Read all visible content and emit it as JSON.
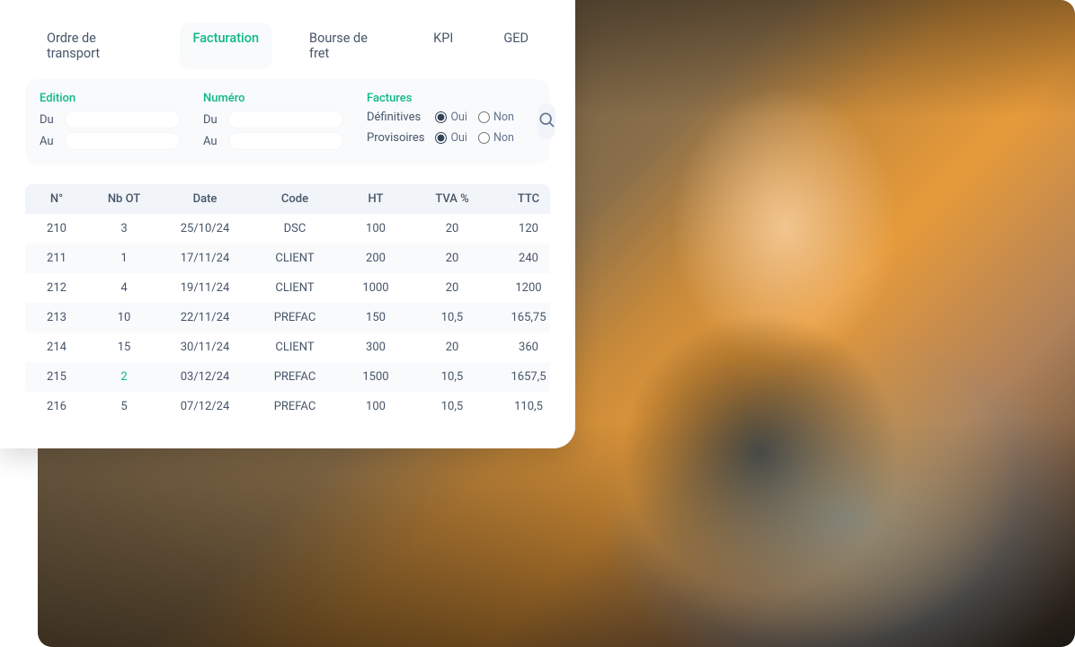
{
  "tabs": [
    {
      "label": "Ordre de transport"
    },
    {
      "label": "Facturation"
    },
    {
      "label": "Bourse de fret"
    },
    {
      "label": "KPI"
    },
    {
      "label": "GED"
    }
  ],
  "active_tab_index": 1,
  "filters": {
    "edition": {
      "title": "Edition",
      "from_label": "Du",
      "to_label": "Au",
      "from_value": "",
      "to_value": ""
    },
    "numero": {
      "title": "Numéro",
      "from_label": "Du",
      "to_label": "Au",
      "from_value": "",
      "to_value": ""
    },
    "factures": {
      "title": "Factures",
      "definitives_label": "Définitives",
      "provisoires_label": "Provisoires",
      "yes": "Oui",
      "no": "Non",
      "definitives_value": "Oui",
      "provisoires_value": "Oui"
    }
  },
  "table": {
    "headers": [
      "N°",
      "Nb OT",
      "Date",
      "Code",
      "HT",
      "TVA %",
      "TTC"
    ],
    "rows": [
      {
        "no": "210",
        "nb_ot": "3",
        "date": "25/10/24",
        "code": "DSC",
        "ht": "100",
        "tva": "20",
        "ttc": "120"
      },
      {
        "no": "211",
        "nb_ot": "1",
        "date": "17/11/24",
        "code": "CLIENT",
        "ht": "200",
        "tva": "20",
        "ttc": "240"
      },
      {
        "no": "212",
        "nb_ot": "4",
        "date": "19/11/24",
        "code": "CLIENT",
        "ht": "1000",
        "tva": "20",
        "ttc": "1200"
      },
      {
        "no": "213",
        "nb_ot": "10",
        "date": "22/11/24",
        "code": "PREFAC",
        "ht": "150",
        "tva": "10,5",
        "ttc": "165,75"
      },
      {
        "no": "214",
        "nb_ot": "15",
        "date": "30/11/24",
        "code": "CLIENT",
        "ht": "300",
        "tva": "20",
        "ttc": "360"
      },
      {
        "no": "215",
        "nb_ot": "2",
        "date": "03/12/24",
        "code": "PREFAC",
        "ht": "1500",
        "tva": "10,5",
        "ttc": "1657,5",
        "nb_ot_link": true
      },
      {
        "no": "216",
        "nb_ot": "5",
        "date": "07/12/24",
        "code": "PREFAC",
        "ht": "100",
        "tva": "10,5",
        "ttc": "110,5"
      }
    ]
  },
  "colors": {
    "accent": "#10b981"
  }
}
